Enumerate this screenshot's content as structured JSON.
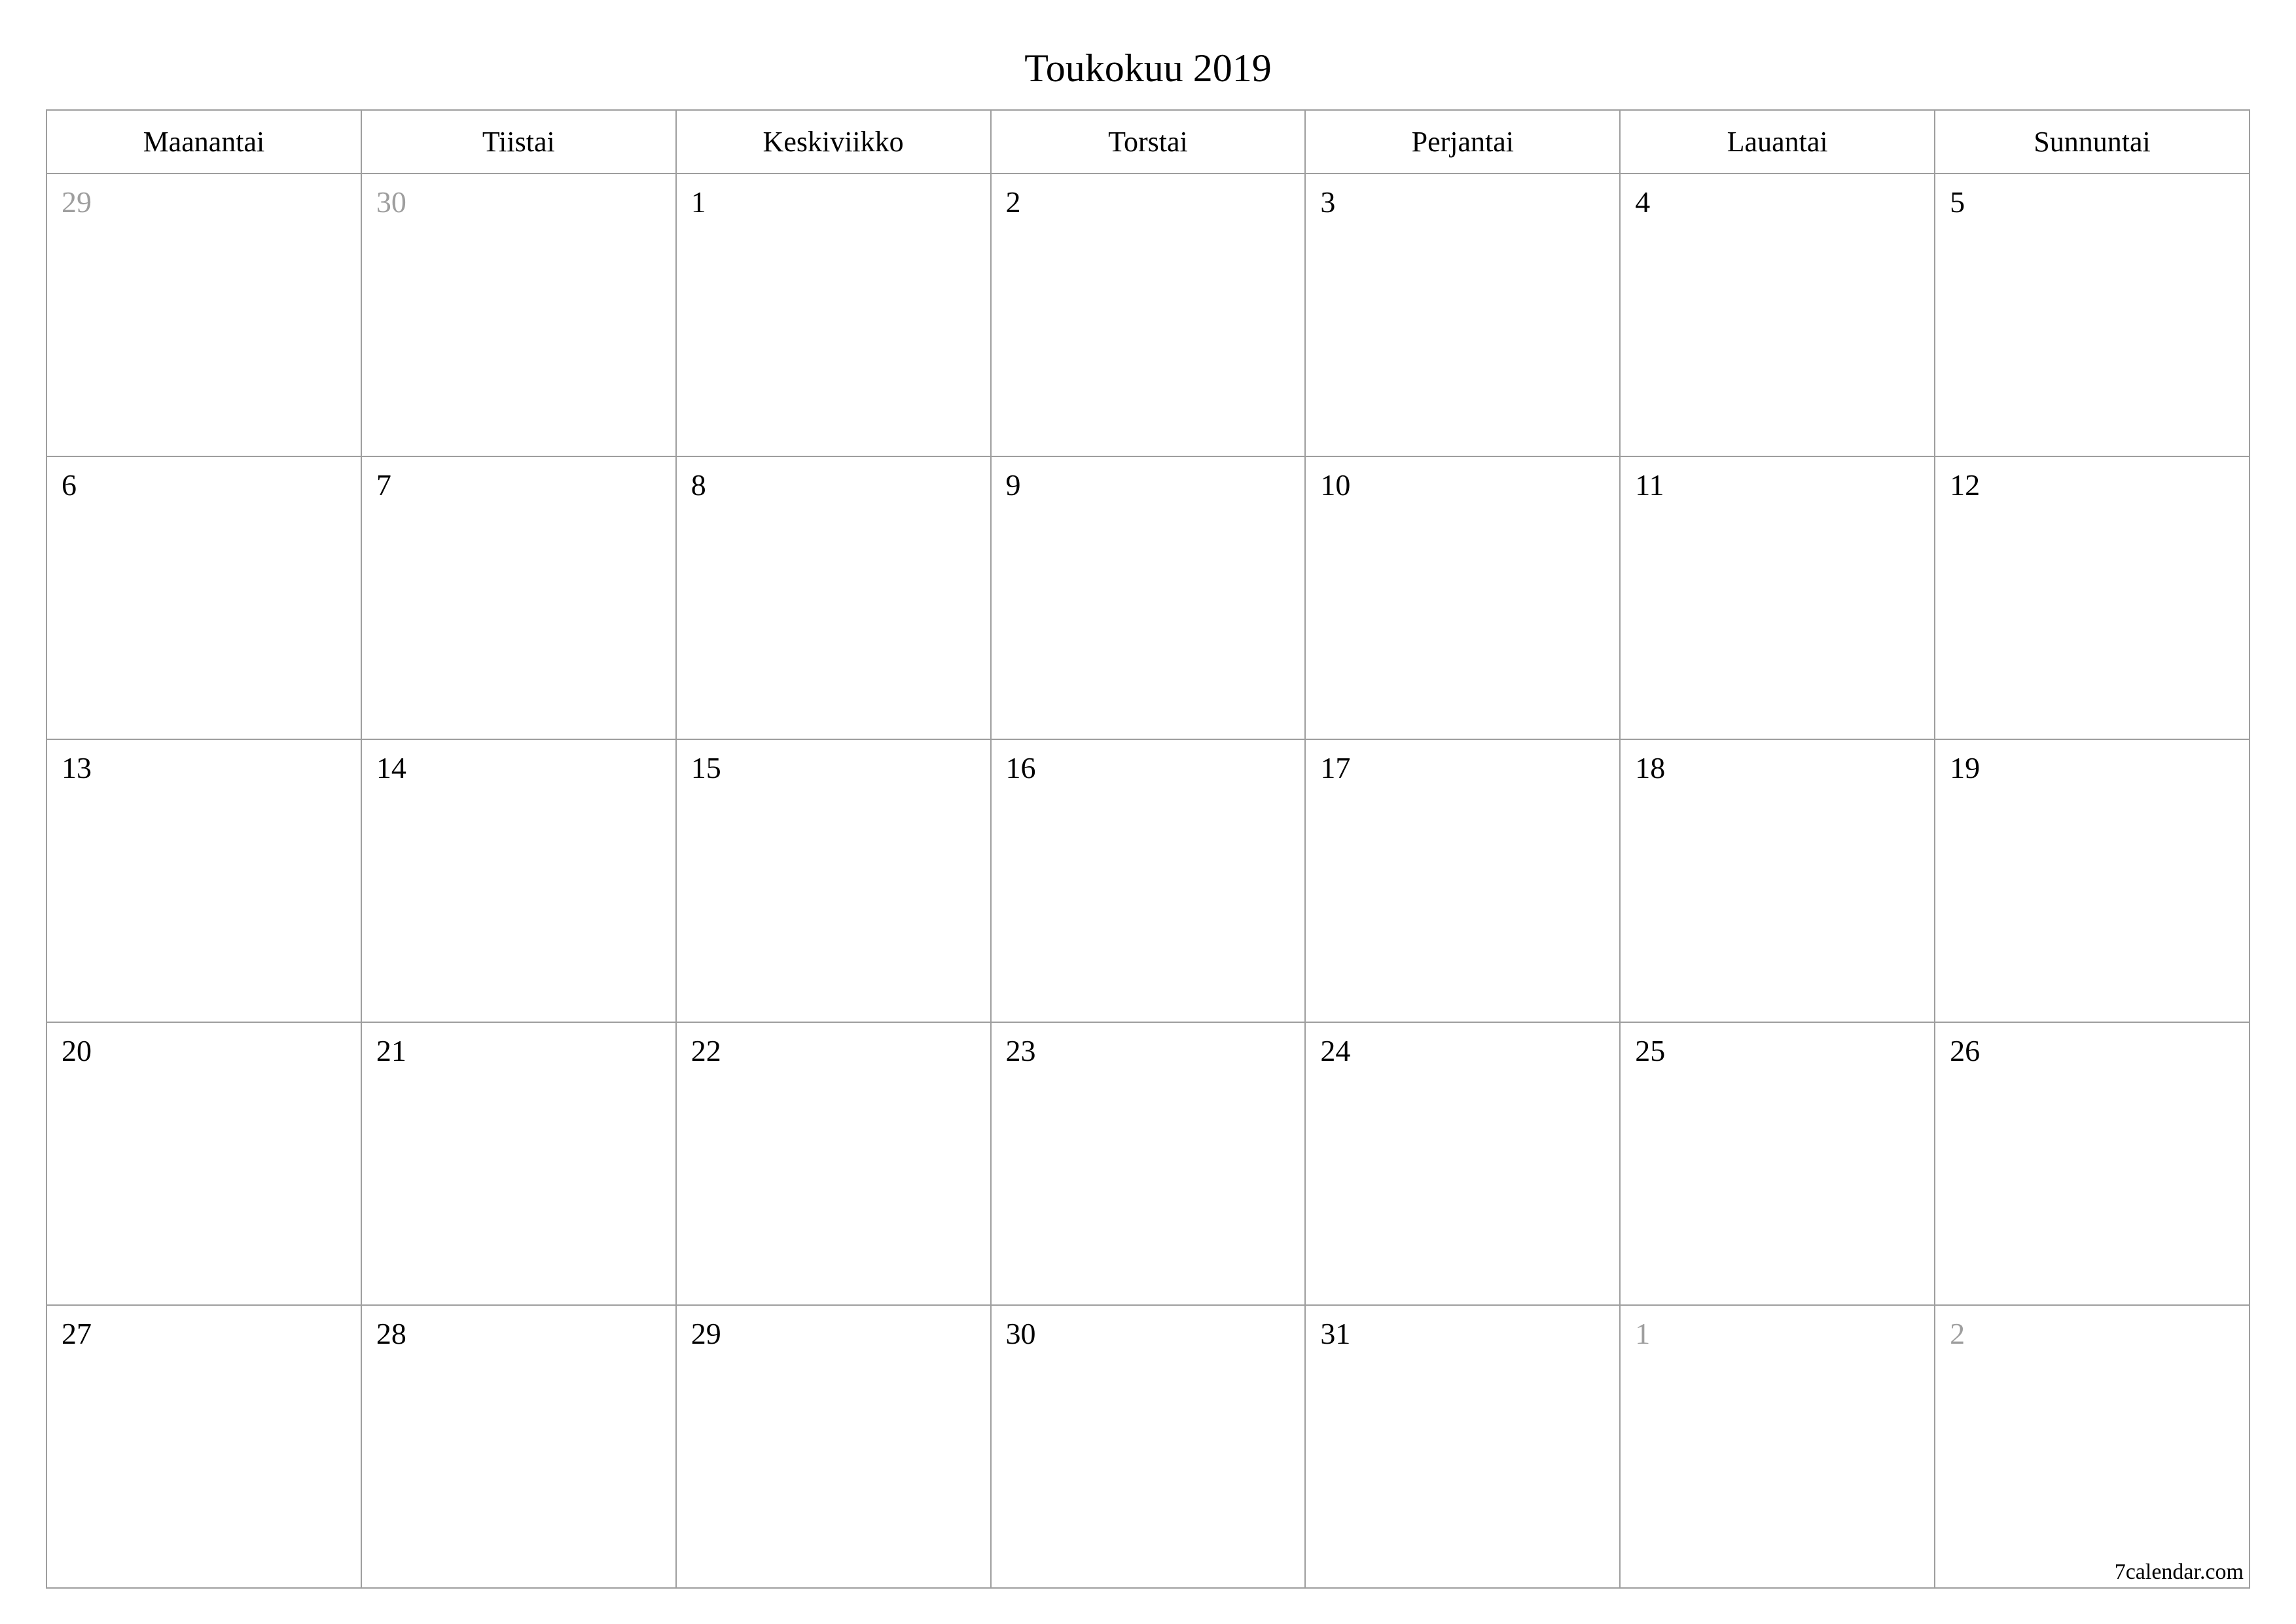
{
  "title": "Toukokuu 2019",
  "weekdays": [
    "Maanantai",
    "Tiistai",
    "Keskiviikko",
    "Torstai",
    "Perjantai",
    "Lauantai",
    "Sunnuntai"
  ],
  "weeks": [
    [
      {
        "n": "29",
        "other": true
      },
      {
        "n": "30",
        "other": true
      },
      {
        "n": "1",
        "other": false
      },
      {
        "n": "2",
        "other": false
      },
      {
        "n": "3",
        "other": false
      },
      {
        "n": "4",
        "other": false
      },
      {
        "n": "5",
        "other": false
      }
    ],
    [
      {
        "n": "6",
        "other": false
      },
      {
        "n": "7",
        "other": false
      },
      {
        "n": "8",
        "other": false
      },
      {
        "n": "9",
        "other": false
      },
      {
        "n": "10",
        "other": false
      },
      {
        "n": "11",
        "other": false
      },
      {
        "n": "12",
        "other": false
      }
    ],
    [
      {
        "n": "13",
        "other": false
      },
      {
        "n": "14",
        "other": false
      },
      {
        "n": "15",
        "other": false
      },
      {
        "n": "16",
        "other": false
      },
      {
        "n": "17",
        "other": false
      },
      {
        "n": "18",
        "other": false
      },
      {
        "n": "19",
        "other": false
      }
    ],
    [
      {
        "n": "20",
        "other": false
      },
      {
        "n": "21",
        "other": false
      },
      {
        "n": "22",
        "other": false
      },
      {
        "n": "23",
        "other": false
      },
      {
        "n": "24",
        "other": false
      },
      {
        "n": "25",
        "other": false
      },
      {
        "n": "26",
        "other": false
      }
    ],
    [
      {
        "n": "27",
        "other": false
      },
      {
        "n": "28",
        "other": false
      },
      {
        "n": "29",
        "other": false
      },
      {
        "n": "30",
        "other": false
      },
      {
        "n": "31",
        "other": false
      },
      {
        "n": "1",
        "other": true
      },
      {
        "n": "2",
        "other": true
      }
    ]
  ],
  "footer": "7calendar.com"
}
